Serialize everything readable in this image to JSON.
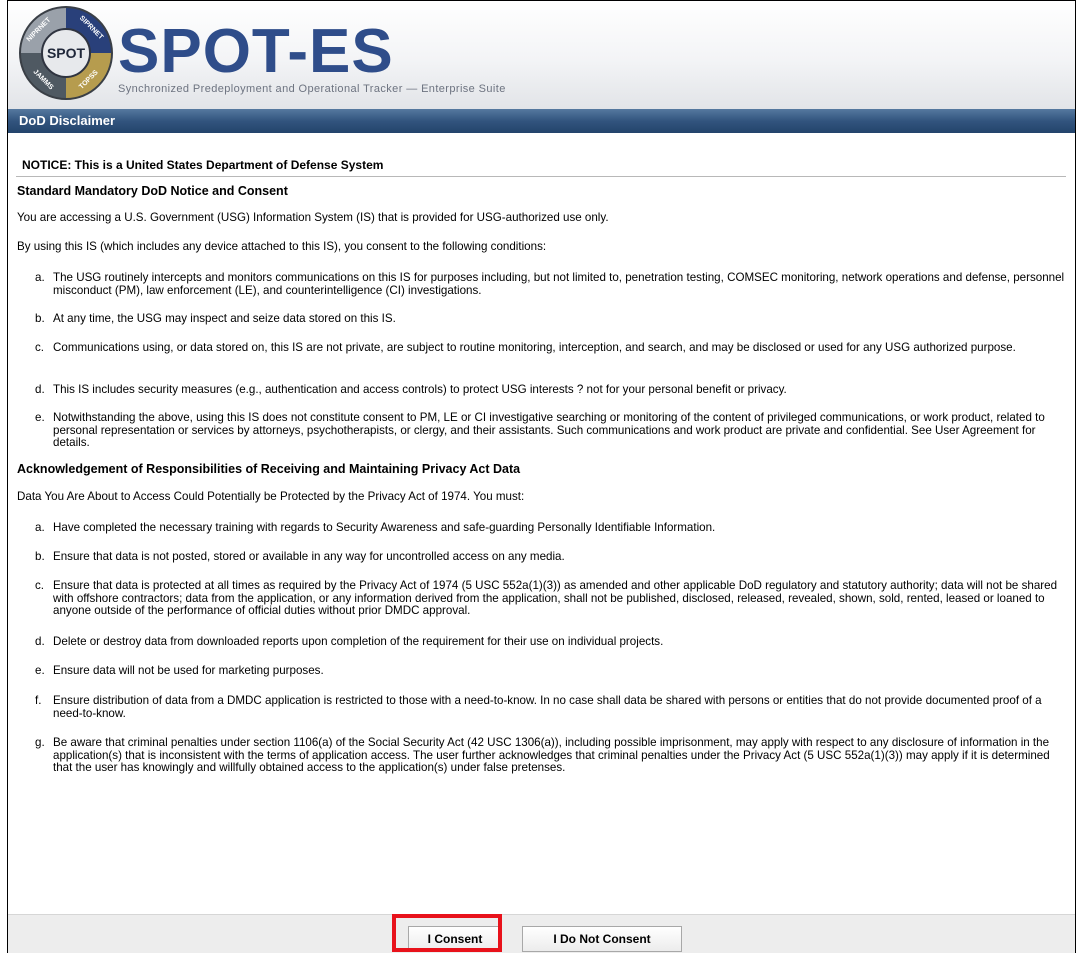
{
  "header": {
    "brand": "SPOT-ES",
    "subtitle": "Synchronized Predeployment and Operational Tracker — Enterprise Suite",
    "seal_text": {
      "top_left": "NIPRNET",
      "top_right": "SIPRNET",
      "center": "SPOT",
      "bottom_left": "JAMMS",
      "bottom_right": "TOPSS"
    }
  },
  "title": "DoD Disclaimer",
  "notice": "NOTICE: This is a United States Department of Defense System",
  "section1": {
    "heading": "Standard Mandatory DoD Notice and Consent",
    "p1": "You are accessing a U.S. Government (USG) Information System (IS) that is provided for USG-authorized use only.",
    "p2": "By using this IS (which includes any device attached to this IS), you consent to the following conditions:",
    "items": [
      {
        "marker": "a.",
        "text": "The USG routinely intercepts and monitors communications on this IS for purposes including, but not limited to, penetration testing, COMSEC monitoring, network operations and defense, personnel misconduct (PM), law enforcement (LE), and counterintelligence (CI) investigations."
      },
      {
        "marker": "b.",
        "text": "At any time, the USG may inspect and seize data stored on this IS."
      },
      {
        "marker": "c.",
        "text": "Communications using, or data stored on, this IS are not private, are subject to routine monitoring, interception, and search, and may be disclosed or used for any USG authorized purpose."
      },
      {
        "marker": "d.",
        "text": "This IS includes security measures (e.g., authentication and access controls) to protect USG interests ? not for your personal benefit or privacy."
      },
      {
        "marker": "e.",
        "text": "Notwithstanding the above, using this IS does not constitute consent to PM, LE or CI investigative searching or monitoring of the content of privileged communications, or work product, related to personal representation or services by attorneys, psychotherapists, or clergy, and their assistants. Such communications and work product are private and confidential. See User Agreement for details."
      }
    ]
  },
  "section2": {
    "heading": "Acknowledgement of Responsibilities of Receiving and Maintaining Privacy Act Data",
    "p1": "Data You Are About to Access Could Potentially be Protected by the Privacy Act of 1974. You must:",
    "items": [
      {
        "marker": "a.",
        "text": "Have completed the necessary training with regards to Security Awareness and safe-guarding Personally Identifiable Information."
      },
      {
        "marker": "b.",
        "text": "Ensure that data is not posted, stored or available in any way for uncontrolled access on any media."
      },
      {
        "marker": "c.",
        "text": "Ensure that data is protected at all times as required by the Privacy Act of 1974 (5 USC 552a(1)(3)) as amended and other applicable DoD regulatory and statutory authority; data will not be shared with offshore contractors; data from the application, or any information derived from the application, shall not be published, disclosed, released, revealed, shown, sold, rented, leased or loaned to anyone outside of the performance of official duties without prior DMDC approval."
      },
      {
        "marker": "d.",
        "text": "Delete or destroy data from downloaded reports upon completion of the requirement for their use on individual projects."
      },
      {
        "marker": "e.",
        "text": "Ensure data will not be used for marketing purposes."
      },
      {
        "marker": "f.",
        "text": "Ensure distribution of data from a DMDC application is restricted to those with a need-to-know. In no case shall data be shared with persons or entities that do not provide documented proof of a need-to-know."
      },
      {
        "marker": "g.",
        "text": "Be aware that criminal penalties under section 1106(a) of the Social Security Act (42 USC 1306(a)), including possible imprisonment, may apply with respect to any disclosure of information in the application(s) that is inconsistent with the terms of application access. The user further acknowledges that criminal penalties under the Privacy Act (5 USC 552a(1)(3)) may apply if it is determined that the user has knowingly and willfully obtained access to the application(s) under false pretenses."
      }
    ]
  },
  "buttons": {
    "consent": "I Consent",
    "no_consent": "I Do Not Consent"
  },
  "colors": {
    "title_bar": "#32547e",
    "brand": "#2f4d8a",
    "highlight": "#e8121b"
  }
}
